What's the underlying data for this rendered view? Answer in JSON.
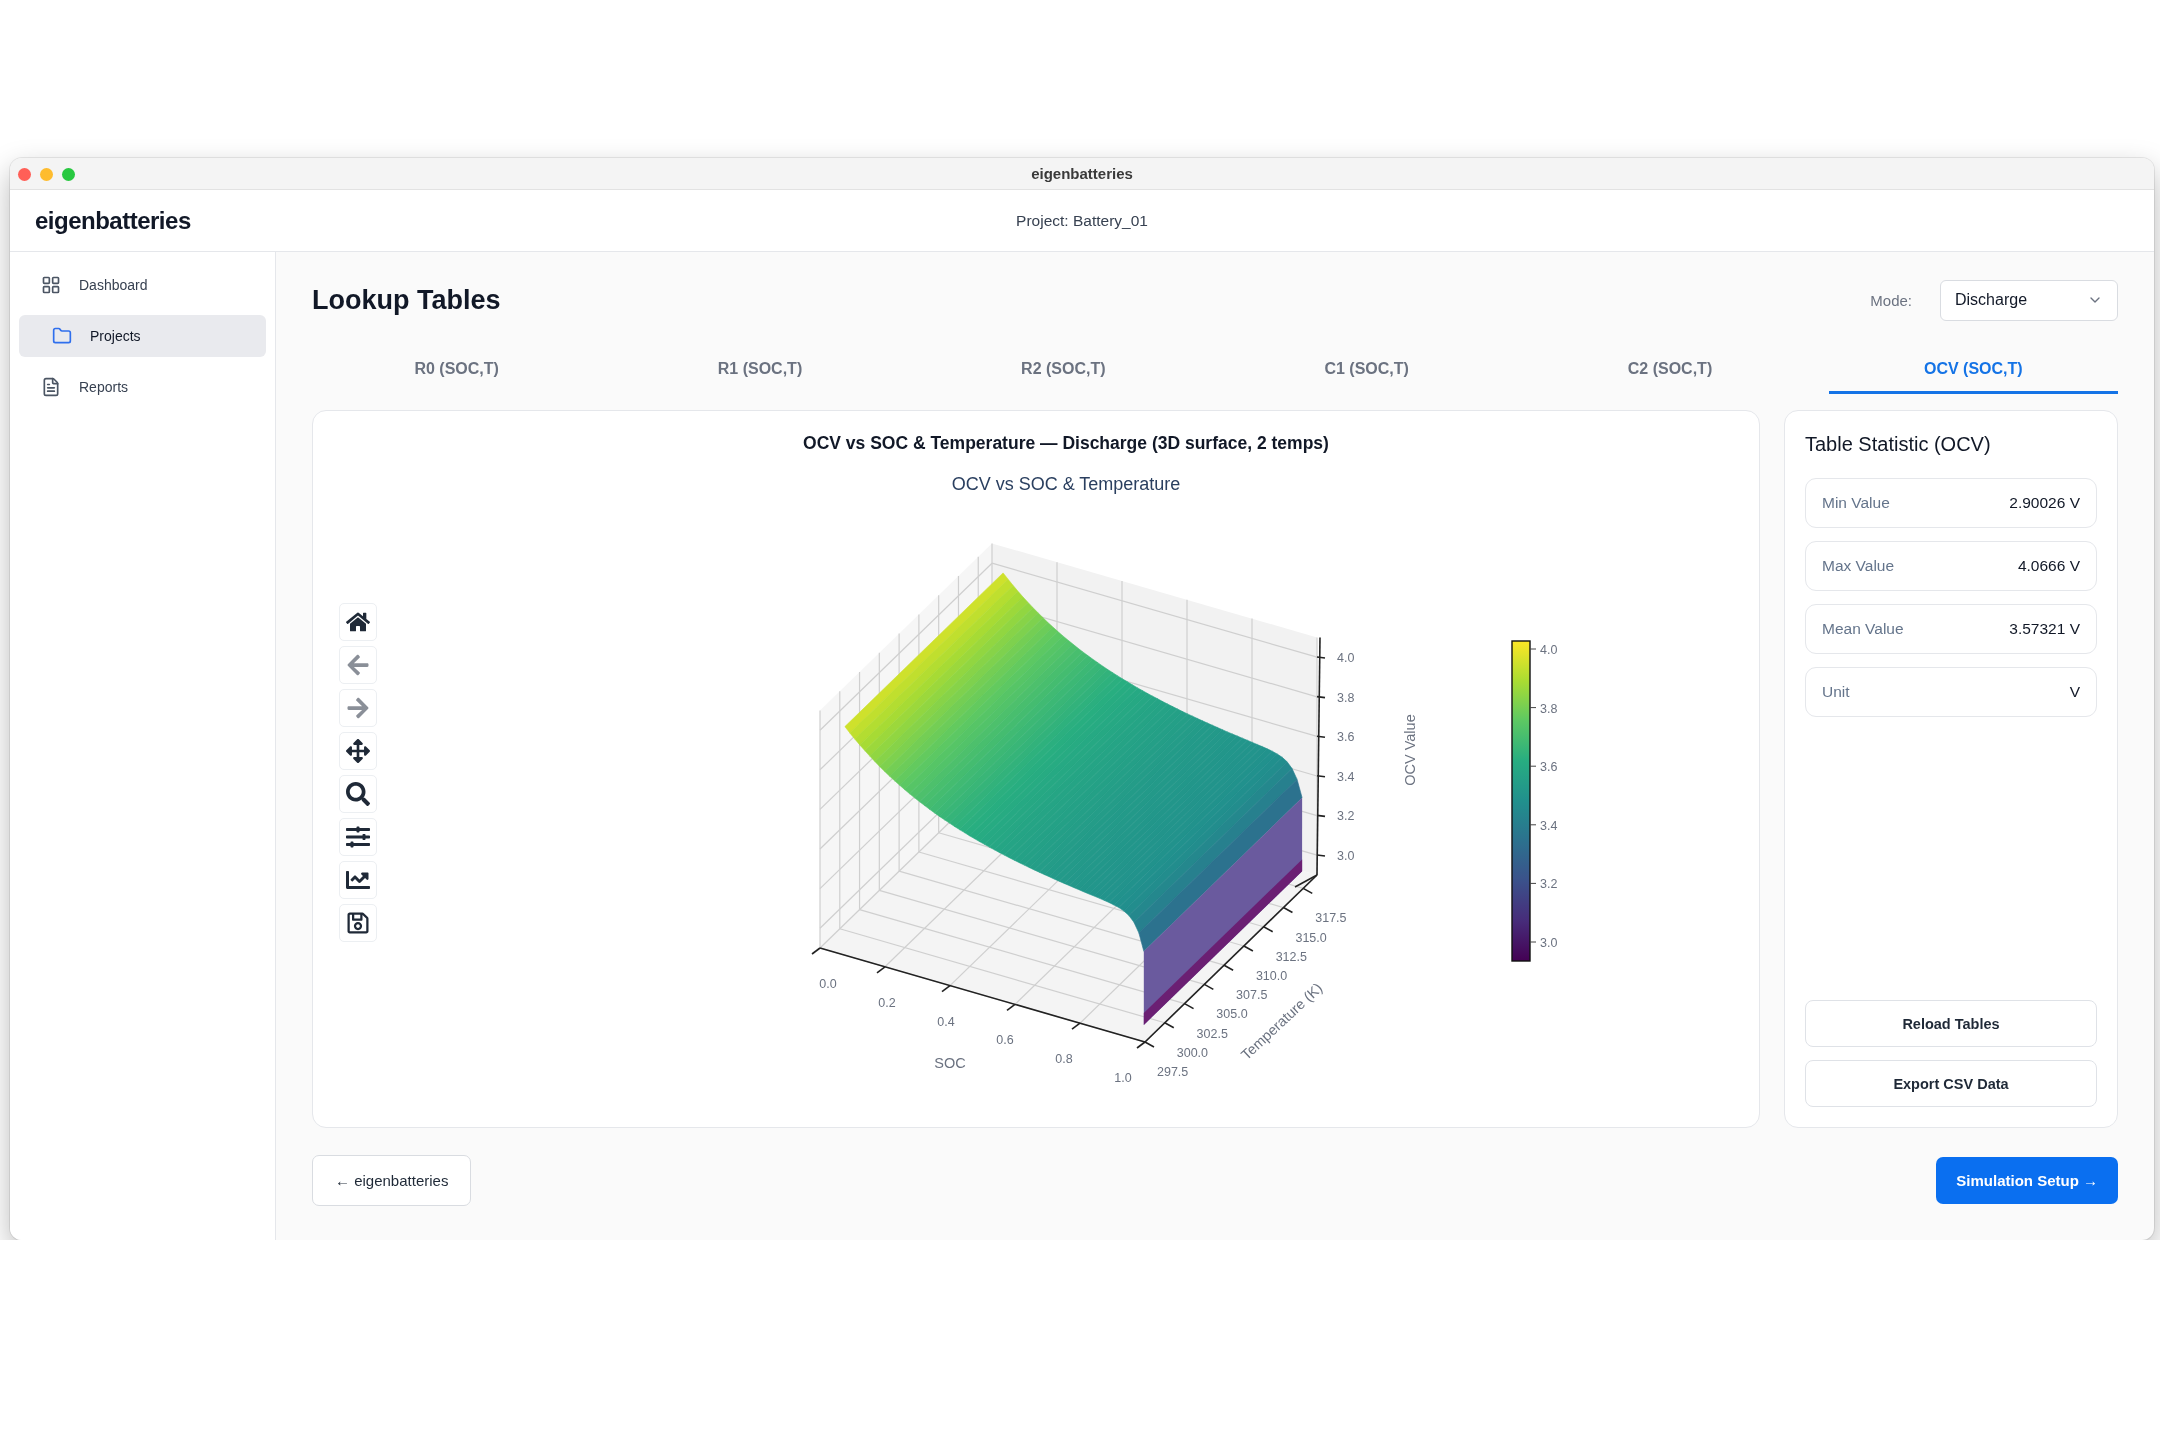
{
  "window": {
    "title": "eigenbatteries"
  },
  "header": {
    "brand": "eigenbatteries",
    "project": "Project: Battery_01"
  },
  "sidebar": {
    "items": [
      {
        "kind": "dashboard",
        "label": "Dashboard",
        "selected": false
      },
      {
        "kind": "projects",
        "label": "Projects",
        "selected": true
      },
      {
        "kind": "reports",
        "label": "Reports",
        "selected": false
      }
    ]
  },
  "page": {
    "title": "Lookup Tables",
    "mode_label": "Mode:",
    "mode_value": "Discharge"
  },
  "tabs": [
    {
      "label": "R0 (SOC,T)",
      "selected": false
    },
    {
      "label": "R1 (SOC,T)",
      "selected": false
    },
    {
      "label": "R2 (SOC,T)",
      "selected": false
    },
    {
      "label": "C1 (SOC,T)",
      "selected": false
    },
    {
      "label": "C2 (SOC,T)",
      "selected": false
    },
    {
      "label": "OCV (SOC,T)",
      "selected": true
    }
  ],
  "chart": {
    "title": "OCV vs SOC & Temperature — Discharge (3D surface, 2 temps)",
    "plot_title": "OCV vs SOC & Temperature",
    "toolbar": [
      {
        "kind": "home",
        "disabled": false
      },
      {
        "kind": "back",
        "disabled": true
      },
      {
        "kind": "forward",
        "disabled": true
      },
      {
        "kind": "pan",
        "disabled": false
      },
      {
        "kind": "zoom",
        "disabled": false
      },
      {
        "kind": "sliders",
        "disabled": false
      },
      {
        "kind": "trend",
        "disabled": false
      },
      {
        "kind": "save",
        "disabled": false
      }
    ],
    "soc_axis": {
      "title": "SOC",
      "ticks": [
        "0.0",
        "0.2",
        "0.4",
        "0.6",
        "0.8",
        "1.0"
      ]
    },
    "temperature_axis": {
      "title": "Temperature (K)",
      "ticks": [
        "297.5",
        "300.0",
        "302.5",
        "305.0",
        "307.5",
        "310.0",
        "312.5",
        "315.0",
        "317.5"
      ]
    },
    "ocv_axis": {
      "title": "OCV Value",
      "ticks": [
        "4.0",
        "3.8",
        "3.6",
        "3.4",
        "3.2",
        "3.0"
      ]
    },
    "colorbar": {
      "ticks": [
        "4.0",
        "3.8",
        "3.6",
        "3.4",
        "3.2",
        "3.0"
      ]
    }
  },
  "stats": {
    "title": "Table Statistic (OCV)",
    "rows": [
      {
        "label": "Min Value",
        "value": "2.90026 V"
      },
      {
        "label": "Max Value",
        "value": "4.0666 V"
      },
      {
        "label": "Mean Value",
        "value": "3.57321 V"
      },
      {
        "label": "Unit",
        "value": "V"
      }
    ],
    "buttons": [
      "Reload Tables",
      "Export CSV Data"
    ]
  },
  "footer": {
    "back": "← eigenbatteries",
    "next": "Simulation Setup →"
  }
}
